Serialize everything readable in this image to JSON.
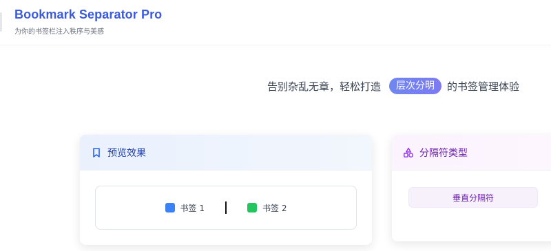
{
  "header": {
    "title": "Bookmark Separator Pro",
    "subtitle": "为你的书签栏注入秩序与美感"
  },
  "tagline": {
    "before": "告别杂乱无章，轻松打造",
    "highlight": "层次分明",
    "after": "的书签管理体验"
  },
  "preview_card": {
    "title": "预览效果",
    "icon": "bookmark-icon",
    "bookmarks": [
      {
        "label": "书签 1",
        "color": "#3b82f6"
      },
      {
        "label": "书签 2",
        "color": "#22c55e"
      }
    ]
  },
  "types_card": {
    "title": "分隔符类型",
    "icon": "shapes-icon",
    "options": [
      {
        "label": "垂直分隔符"
      }
    ]
  },
  "colors": {
    "brand": "#3b5bdb",
    "preview_accent": "#1e40af",
    "types_accent": "#6b21a8"
  }
}
